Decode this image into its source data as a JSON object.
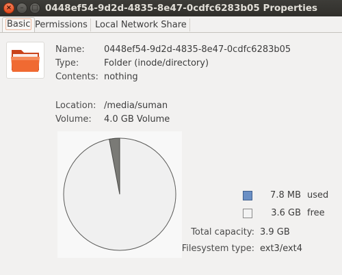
{
  "window": {
    "title": "0448ef54-9d2d-4835-8e47-0cdfc6283b05 Properties",
    "close_glyph": "×",
    "min_glyph": "–",
    "max_glyph": "□"
  },
  "tabs": [
    {
      "label": "Basic",
      "active": true
    },
    {
      "label": "Permissions",
      "active": false
    },
    {
      "label": "Local Network Share",
      "active": false
    }
  ],
  "icon": {
    "name": "folder-icon",
    "color": "#e95420"
  },
  "info": {
    "name_label": "Name:",
    "name_value": "0448ef54-9d2d-4835-8e47-0cdfc6283b05",
    "type_label": "Type:",
    "type_value": "Folder (inode/directory)",
    "contents_label": "Contents:",
    "contents_value": "nothing",
    "location_label": "Location:",
    "location_value": "/media/suman",
    "volume_label": "Volume:",
    "volume_value": "4.0 GB Volume"
  },
  "usage": {
    "used_value": "7.8 MB",
    "used_label": "used",
    "used_color": "#6a8fc4",
    "free_value": "3.6 GB",
    "free_label": "free",
    "free_color": "#f3f3f3",
    "total_label": "Total capacity:",
    "total_value": "3.9 GB",
    "fs_label": "Filesystem type:",
    "fs_value": "ext3/ext4"
  },
  "chart_data": {
    "type": "pie",
    "slices": [
      {
        "label": "used",
        "fraction": 0.03,
        "color": "#7a7a76"
      },
      {
        "label": "free",
        "fraction": 0.97,
        "color": "#f0f0f0"
      }
    ]
  }
}
